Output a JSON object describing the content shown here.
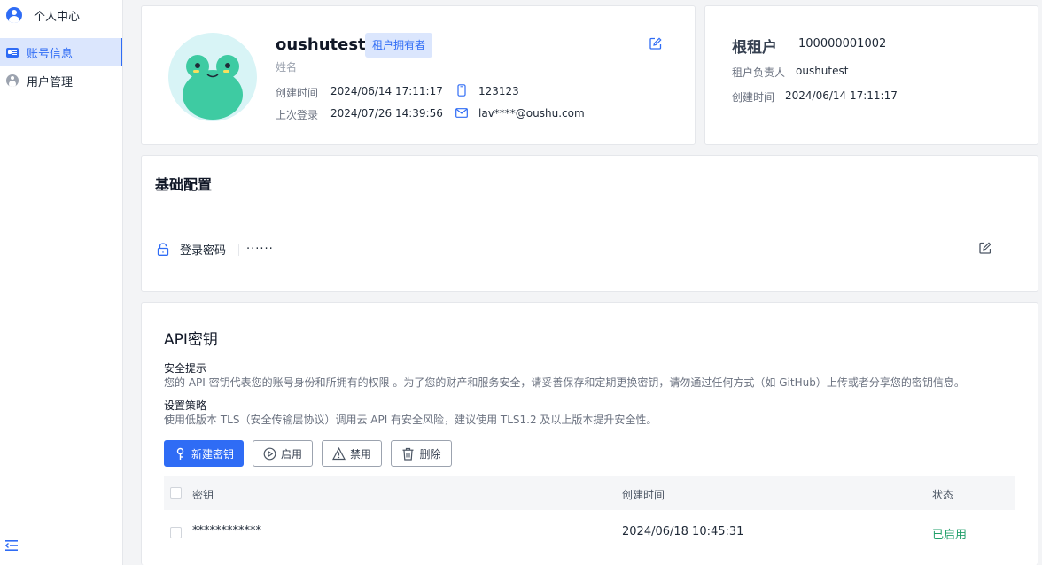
{
  "sidebar": {
    "header": "个人中心",
    "items": [
      {
        "label": "账号信息",
        "active": true
      },
      {
        "label": "用户管理",
        "active": false
      }
    ]
  },
  "profile": {
    "name": "oushutest",
    "badge": "租户拥有者",
    "subtitle": "姓名",
    "created_label": "创建时间",
    "created_value": "2024/06/14 17:11:17",
    "last_login_label": "上次登录",
    "last_login_value": "2024/07/26 14:39:56",
    "phone": "123123",
    "email": "lav****@oushu.com"
  },
  "tenant": {
    "title": "根租户",
    "id": "100000001002",
    "owner_label": "租户负责人",
    "owner_value": "oushutest",
    "created_label": "创建时间",
    "created_value": "2024/06/14 17:11:17"
  },
  "config": {
    "title": "基础配置",
    "password_label": "登录密码",
    "password_value": "······"
  },
  "api": {
    "title": "API密钥",
    "tip1_title": "安全提示",
    "tip1_body": "您的 API 密钥代表您的账号身份和所拥有的权限 。为了您的财产和服务安全，请妥善保存和定期更换密钥，请勿通过任何方式（如 GitHub）上传或者分享您的密钥信息。",
    "tip2_title": "设置策略",
    "tip2_body": "使用低版本 TLS（安全传输层协议）调用云 API 有安全风险，建议使用 TLS1.2 及以上版本提升安全性。",
    "buttons": {
      "new": "新建密钥",
      "enable": "启用",
      "disable": "禁用",
      "delete": "删除"
    },
    "columns": [
      "密钥",
      "创建时间",
      "状态"
    ],
    "rows": [
      {
        "key": "************",
        "created": "2024/06/18 10:45:31",
        "status": "已启用"
      }
    ]
  },
  "colors": {
    "primary": "#2f6cf5",
    "success": "#22a06b"
  }
}
